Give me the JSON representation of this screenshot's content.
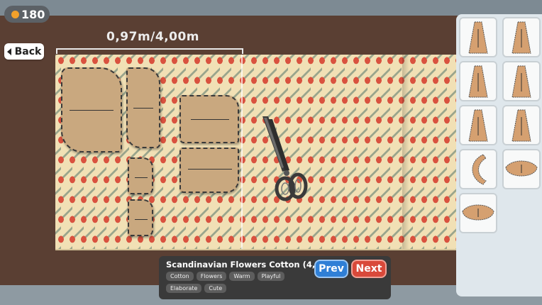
{
  "hud": {
    "coins": "180",
    "coin_color": "#f3a12b"
  },
  "nav": {
    "back_label": "Back"
  },
  "fabric": {
    "length_display": "0,97m/4,00m",
    "used_m": 0.97,
    "total_m": 4.0,
    "name": "Scandinavian Flowers Cotton (4,0m)",
    "tags": [
      "Cotton",
      "Flowers",
      "Warm",
      "Playful",
      "Elaborate",
      "Cute"
    ],
    "pattern_colors": {
      "background": "#f1e0b5",
      "flower": "#d9523f",
      "leaf": "#9aa58c"
    }
  },
  "buttons": {
    "prev_label": "Prev",
    "next_label": "Next",
    "prev_color": "#2f7fd6",
    "next_color": "#d9493a"
  },
  "tools": {
    "cutting_tool": "scissors-icon"
  },
  "piece_inventory": [
    "skirt-panel-icon",
    "skirt-panel-icon",
    "skirt-panel-icon",
    "skirt-panel-icon",
    "skirt-panel-icon",
    "skirt-panel-icon",
    "curved-strip-icon",
    "collar-piece-icon",
    "collar-piece-icon"
  ]
}
